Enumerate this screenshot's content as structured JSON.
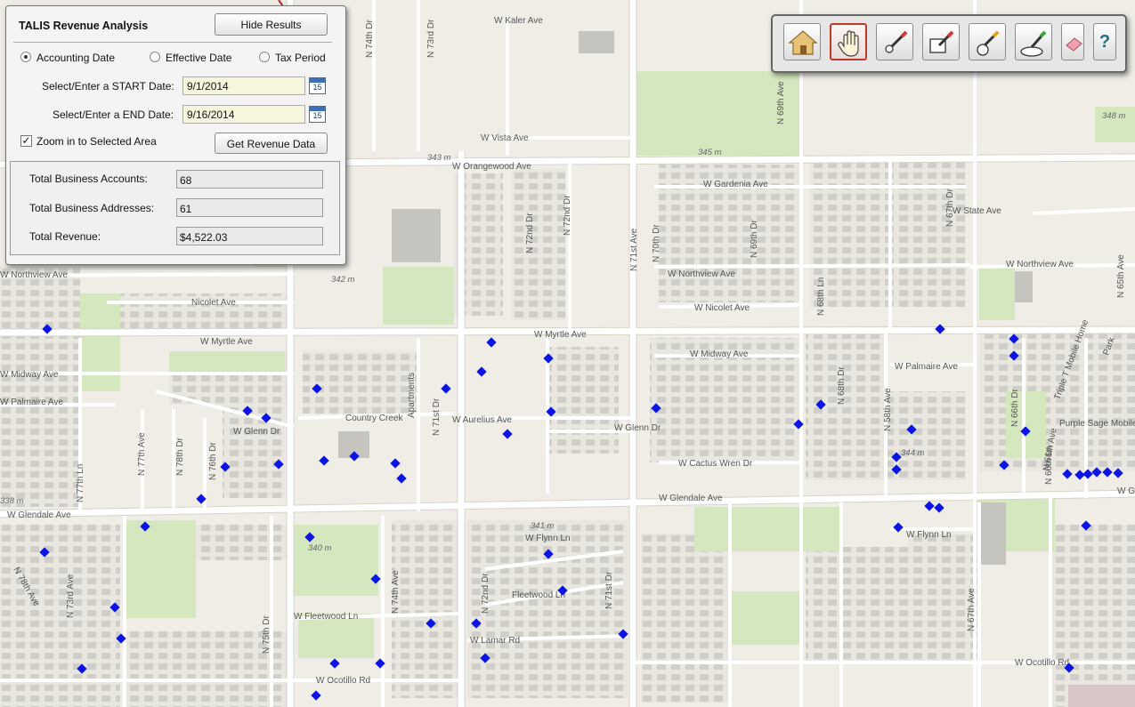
{
  "panel": {
    "title": "TALIS Revenue Analysis",
    "hide_results_label": "Hide Results",
    "date_modes": [
      {
        "label": "Accounting Date",
        "selected": true
      },
      {
        "label": "Effective Date",
        "selected": false
      },
      {
        "label": "Tax Period",
        "selected": false
      }
    ],
    "start_label": "Select/Enter a START Date:",
    "start_value": "9/1/2014",
    "end_label": "Select/Enter a END Date:",
    "end_value": "9/16/2014",
    "calendar_text": "15",
    "zoom_label": "Zoom in to Selected Area",
    "zoom_checked": true,
    "get_data_label": "Get Revenue Data",
    "results": {
      "accounts_label": "Total Business Accounts:",
      "accounts_value": "68",
      "addresses_label": "Total Business Addresses:",
      "addresses_value": "61",
      "revenue_label": "Total Revenue:",
      "revenue_value": "$4,522.03"
    }
  },
  "toolbar": {
    "buttons": [
      "home-icon",
      "pan-hand-icon",
      "draw-point-icon",
      "draw-rectangle-icon",
      "draw-circle-icon",
      "draw-polygon-icon",
      "eraser-icon",
      "help-icon"
    ],
    "active": "pan-hand-icon",
    "help_glyph": "?"
  },
  "map": {
    "colors": {
      "block": "#e6e4dc",
      "park": "#d4e7bf",
      "street": "#ffffff",
      "arterial": "#fdfdfb",
      "building": "#c9c8c4",
      "marker": "#0a14e6"
    },
    "street_labels": {
      "s1": "W Kaler Ave",
      "s2": "W Vista Ave",
      "s3": "W Orangewood Ave",
      "s4": "W Gardenia Ave",
      "s5": "W State Ave",
      "s6": "W Northview Ave",
      "s7": "W Northview Ave",
      "s8": "W Northview Ave",
      "s9": "Nicolet Ave",
      "s10": "W Nicolet Ave",
      "s11": "W Myrtle Ave",
      "s12": "W Myrtle Ave",
      "s13": "W Midway Ave",
      "s14": "W Midway Ave",
      "s15": "W Palmaire Ave",
      "s16": "W Palmaire Ave",
      "s17": "Country Creek",
      "s18": "W Aurelius Ave",
      "s19": "W Glenn Dr",
      "s20": "W Glenn Dr",
      "s21": "W Cactus Wren Dr",
      "s22": "Purple Sage Mobile",
      "s23": "W Glendale Ave",
      "s24": "W Glendale Ave",
      "s25": "W Gle",
      "s26": "W Flynn Ln",
      "s27": "W Flynn Ln",
      "s28": "Fleetwood Ln",
      "s29": "W Fleetwood Ln",
      "s30": "W Lamar Rd",
      "s31": "W Ocotillo Rd",
      "s32": "W Ocotillo Rd",
      "s33": "N 74th Dr",
      "s34": "N 73rd Dr",
      "s35": "N 72nd Dr",
      "s36": "N 72nd Dr",
      "s37": "N 71st Ave",
      "s38": "N 70th Dr",
      "s39": "N 69th Dr",
      "s40": "N 69th Ave",
      "s41": "N 68th Ln",
      "s42": "N 67th Dr",
      "s43": "N 58th Ave",
      "s44": "N 68th Dr",
      "s45": "N 66th Dr",
      "s46": "N 66th Ln",
      "s47": "N 67th Ave",
      "s48": "N 65th Ave",
      "s49": "N 71st Dr",
      "s50": "N 71st Dr",
      "s51": "N 72nd Dr",
      "s52": "N 74th Ave",
      "s53": "N 75th Dr",
      "s54": "N 73rd Ave",
      "s55": "N 77th Ave",
      "s56": "N 77th Ln",
      "s57": "N 78th Dr",
      "s58": "N 76th Dr",
      "s59": "N 78th Ave",
      "s60": "Apartments",
      "s61": "Triple T Mobile Home",
      "s62": "Park",
      "s63": "N 66th Ave"
    },
    "elevations": {
      "e1": "343 m",
      "e2": "345 m",
      "e3": "348 m",
      "e4": "342 m",
      "e5": "344 m",
      "e6": "341 m",
      "e7": "340 m",
      "e8": "338 m"
    }
  }
}
